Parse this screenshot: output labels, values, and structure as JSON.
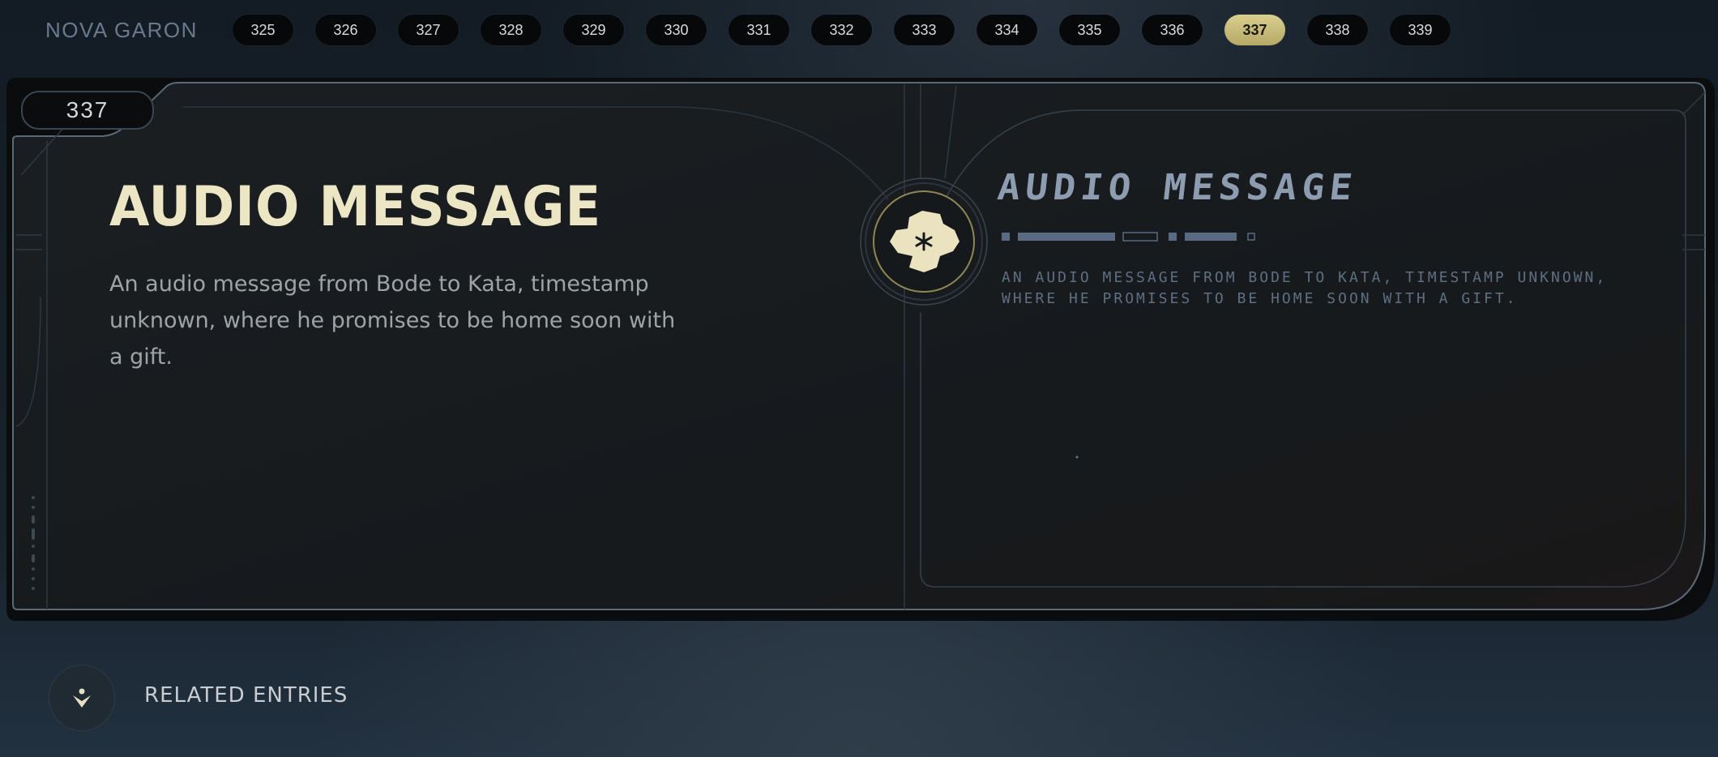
{
  "header": {
    "planet": "NOVA GARON",
    "pages": [
      "325",
      "326",
      "327",
      "328",
      "329",
      "330",
      "331",
      "332",
      "333",
      "334",
      "335",
      "336",
      "337",
      "338",
      "339"
    ],
    "active_page": "337"
  },
  "entry": {
    "number": "337",
    "title": "AUDIO MESSAGE",
    "description": "An audio message from Bode to Kata, timestamp unknown, where he promises to be home soon with a gift.",
    "aurebesh_title": "AUDIO MESSAGE",
    "aurebesh_body": "AN AUDIO MESSAGE FROM BODE TO KATA, TIMESTAMP UNKNOWN, WHERE HE PROMISES TO BE HOME SOON WITH A GIFT."
  },
  "footer": {
    "related_label": "RELATED ENTRIES"
  },
  "icons": {
    "emblem": "audio-log-emblem-icon",
    "related": "related-entries-icon"
  },
  "colors": {
    "accent": "#d9cf8f",
    "title": "#ece6c4",
    "panel": "#181c1f",
    "frame": "#3b4654"
  }
}
